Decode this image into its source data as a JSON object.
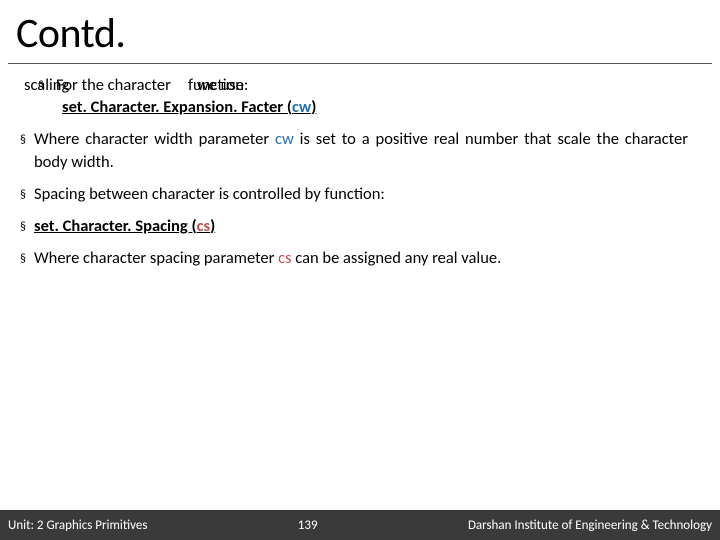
{
  "title": "Contd.",
  "overlap": {
    "a": "scaling",
    "b": "For the character",
    "c": "function:",
    "d": "we use"
  },
  "fn1": {
    "name": "set. Character. Expansion. Facter (",
    "param": "cw",
    "close": ")"
  },
  "bul2": {
    "a": "Where character width parameter ",
    "p": "cw",
    "b": " is set to a positive real number that scale the character body width."
  },
  "bul3": "Spacing between character is controlled by function:",
  "fn2": {
    "name": "set. Character. Spacing (",
    "param": "cs",
    "close": ")"
  },
  "bul5": {
    "a": "Where character spacing parameter ",
    "p": "cs",
    "b": " can be assigned any real value."
  },
  "footer": {
    "left": "Unit: 2 Graphics Primitives",
    "mid": "139",
    "right": "Darshan Institute of Engineering & Technology"
  },
  "bullet": "§"
}
